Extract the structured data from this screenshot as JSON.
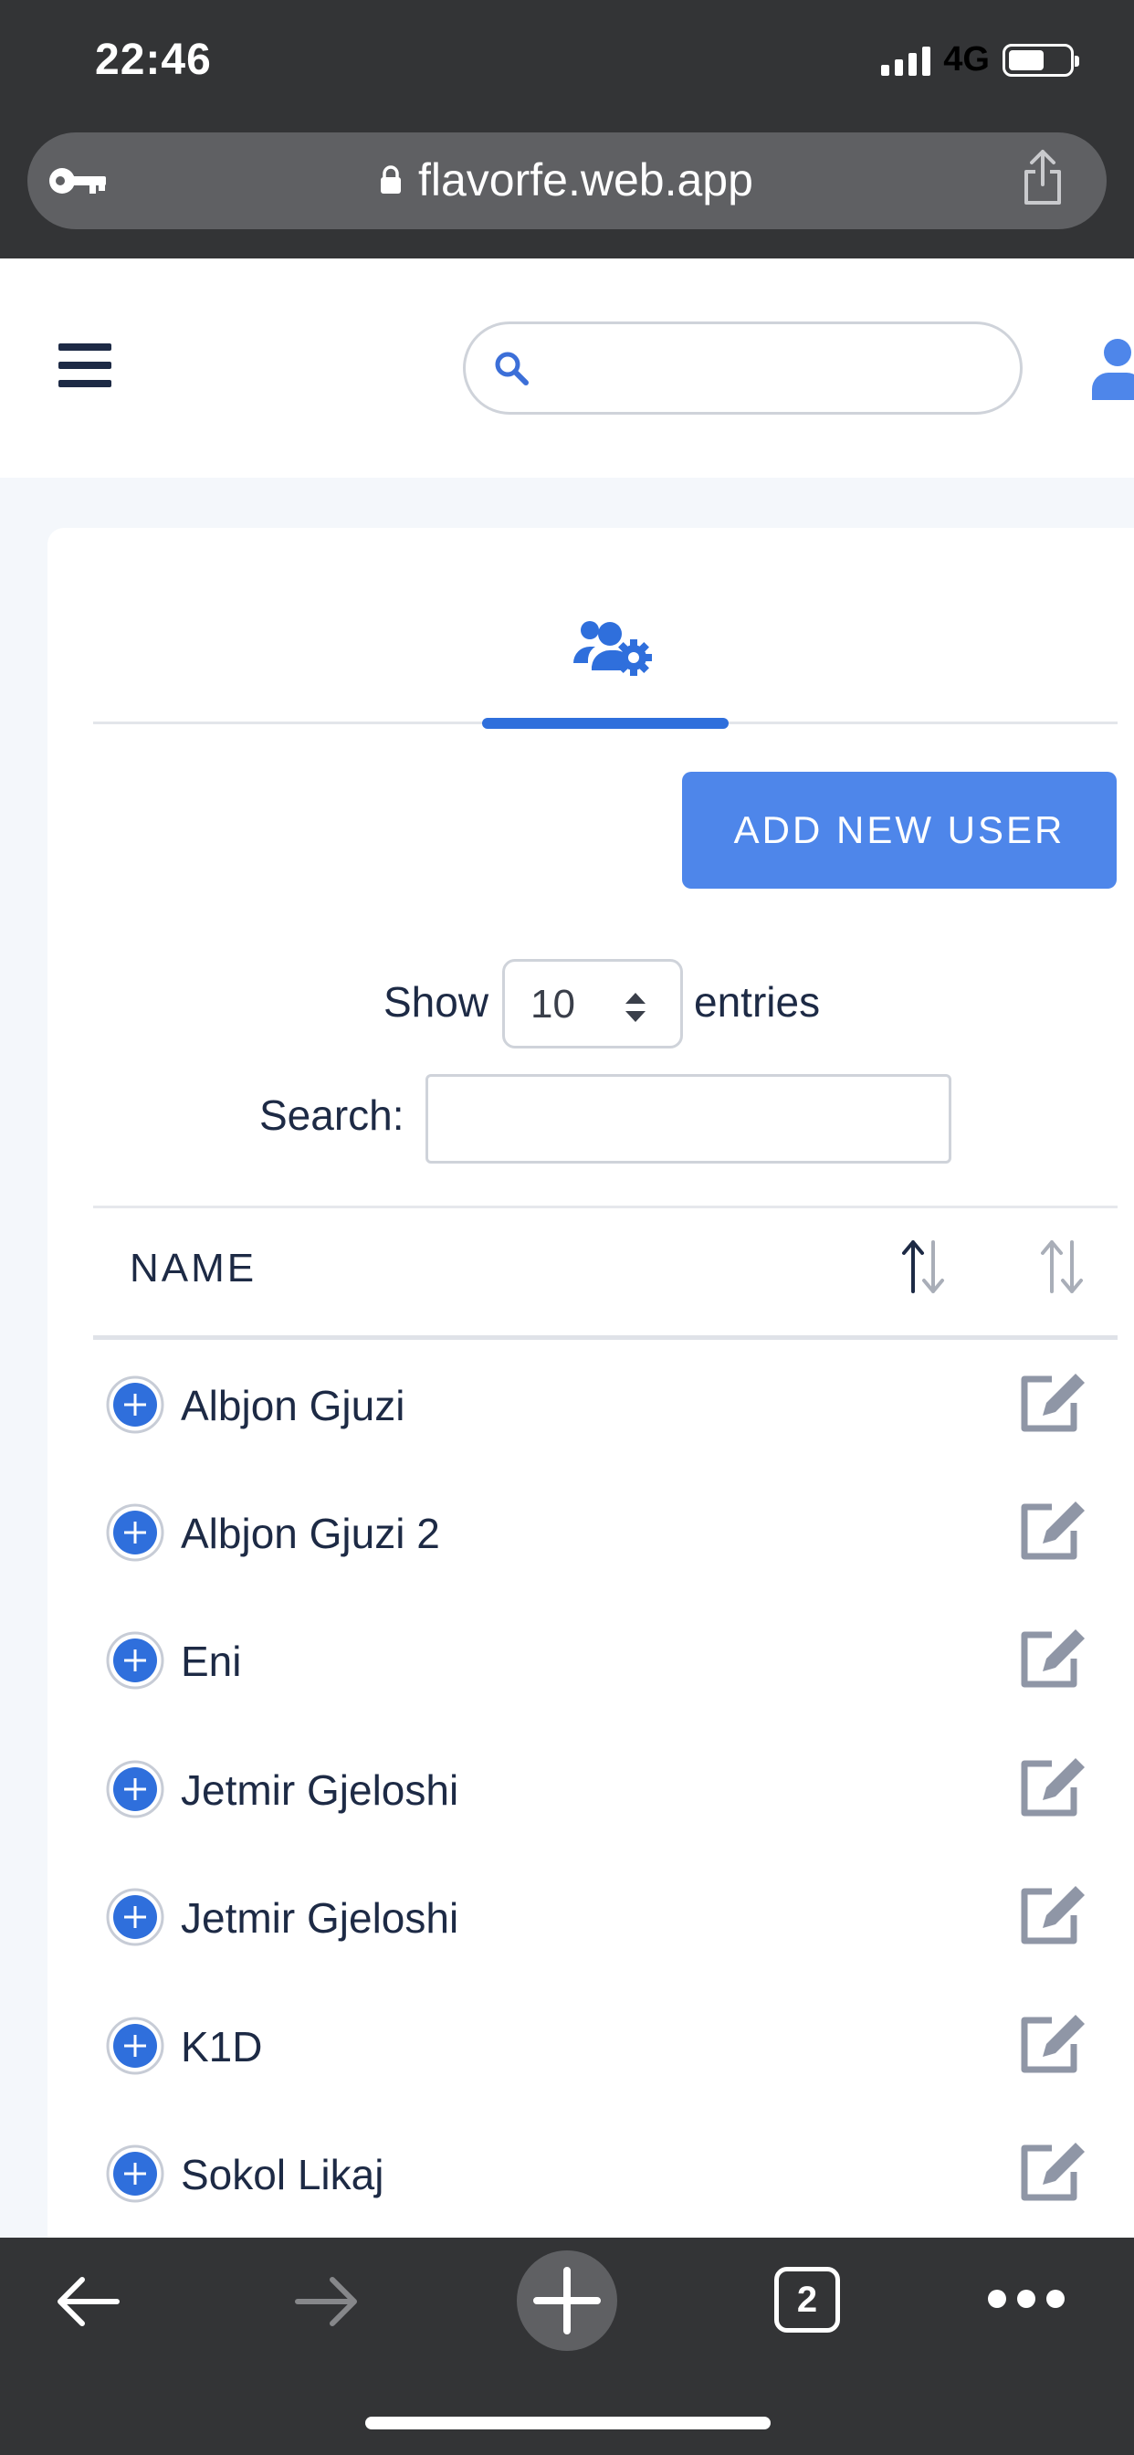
{
  "status_bar": {
    "time": "22:46",
    "network": "4G"
  },
  "browser": {
    "url": "flavorfe.web.app",
    "tab_count": "2"
  },
  "header": {
    "search_placeholder": ""
  },
  "users_panel": {
    "add_button": "ADD NEW USER",
    "show_label": "Show",
    "entries_value": "10",
    "entries_label": "entries",
    "search_label": "Search:",
    "search_value": ""
  },
  "table": {
    "columns": [
      "NAME"
    ],
    "rows": [
      {
        "name": "Albjon Gjuzi"
      },
      {
        "name": "Albjon Gjuzi 2"
      },
      {
        "name": "Eni"
      },
      {
        "name": "Jetmir Gjeloshi"
      },
      {
        "name": "Jetmir Gjeloshi"
      },
      {
        "name": "K1D"
      },
      {
        "name": "Sokol Likaj"
      }
    ]
  },
  "colors": {
    "accent": "#4e86ea",
    "icon_blue": "#2f6fdc",
    "text_dark": "#1d2a45",
    "edit_icon": "#8f96a6",
    "chrome_dark": "#333436"
  },
  "icons": {
    "key": "key-icon",
    "lock": "lock-icon",
    "share": "share-icon",
    "menu": "hamburger-icon",
    "search": "search-icon",
    "user": "user-icon",
    "users_settings": "users-cog-icon",
    "sort": "sort-icon",
    "expand": "plus-circle-icon",
    "edit": "edit-icon",
    "back": "arrow-left-icon",
    "forward": "arrow-right-icon",
    "new_tab": "plus-icon",
    "tabs": "tabs-icon",
    "more": "more-icon"
  }
}
